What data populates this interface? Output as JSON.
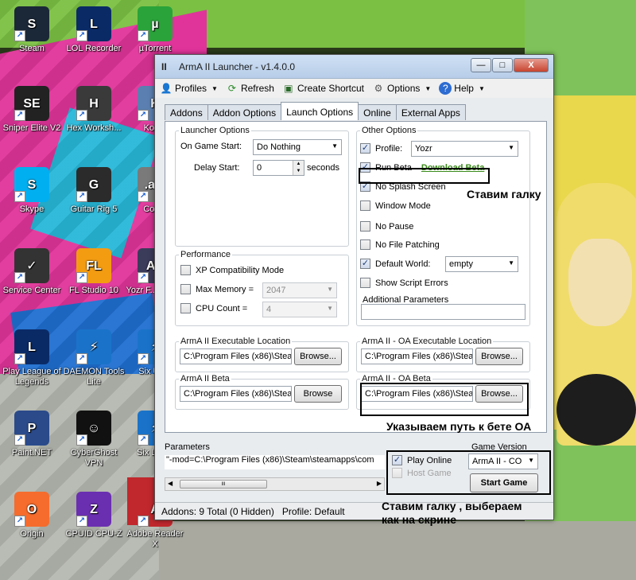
{
  "desktop": {
    "icons": [
      {
        "label": "Steam",
        "glyph": "S",
        "color": "#1b2838"
      },
      {
        "label": "LOL Recorder",
        "glyph": "L",
        "color": "#0a2a66"
      },
      {
        "label": "µTorrent",
        "glyph": "µ",
        "color": "#2aa33a"
      },
      {
        "label": "Sniper Elite V2",
        "glyph": "SE",
        "color": "#222222"
      },
      {
        "label": "Hex Worksh...",
        "glyph": "H",
        "color": "#3a3a3a"
      },
      {
        "label": "Kop...",
        "glyph": "K",
        "color": "#5a7fb0"
      },
      {
        "label": "Skype",
        "glyph": "S",
        "color": "#00aff0"
      },
      {
        "label": "Guitar Rig 5",
        "glyph": "G",
        "color": "#2b2b2b"
      },
      {
        "label": "Con...",
        "glyph": ".avi",
        "color": "#7a7a7a"
      },
      {
        "label": "Service Center",
        "glyph": "✓",
        "color": "#333333"
      },
      {
        "label": "FL Studio 10",
        "glyph": "FL",
        "color": "#f39c12"
      },
      {
        "label": "Yozr F... pres...",
        "glyph": "AE",
        "color": "#3b3b5a"
      },
      {
        "label": "Play League of Legends",
        "glyph": "L",
        "color": "#0a2a66"
      },
      {
        "label": "DAEMON Tools Lite",
        "glyph": "⚡",
        "color": "#1a73c9"
      },
      {
        "label": "Six Up...",
        "glyph": "⚡",
        "color": "#1a73c9"
      },
      {
        "label": "Paint.NET",
        "glyph": "P",
        "color": "#2a4a8a"
      },
      {
        "label": "CyberGhost VPN",
        "glyph": "☺",
        "color": "#111111"
      },
      {
        "label": "Six Lau...",
        "glyph": "⚡",
        "color": "#1a73c9"
      },
      {
        "label": "Origin",
        "glyph": "O",
        "color": "#f56c2d"
      },
      {
        "label": "CPUID CPU-Z",
        "glyph": "Z",
        "color": "#6a2fb0"
      },
      {
        "label": "Adobe Reader X",
        "glyph": "A",
        "color": "#c0282d"
      }
    ]
  },
  "window": {
    "title": "ArmA II Launcher - v1.4.0.0",
    "controls": {
      "minimize": "—",
      "maximize": "□",
      "close": "X"
    }
  },
  "menu": {
    "profiles": "Profiles",
    "refresh": "Refresh",
    "create_shortcut": "Create Shortcut",
    "options": "Options",
    "help": "Help"
  },
  "tabs": [
    "Addons",
    "Addon Options",
    "Launch Options",
    "Online",
    "External Apps"
  ],
  "active_tab": "Launch Options",
  "launcher_options": {
    "legend": "Launcher Options",
    "on_game_start_label": "On Game Start:",
    "on_game_start_value": "Do Nothing",
    "delay_start_label": "Delay Start:",
    "delay_start_value": "0",
    "delay_unit": "seconds"
  },
  "performance": {
    "legend": "Performance",
    "xp_compat": {
      "label": "XP Compatibility Mode",
      "checked": false
    },
    "max_memory": {
      "label": "Max Memory =",
      "checked": false,
      "value": "2047"
    },
    "cpu_count": {
      "label": "CPU Count =",
      "checked": false,
      "value": "4"
    }
  },
  "other_options": {
    "legend": "Other Options",
    "profile": {
      "label": "Profile:",
      "checked": true,
      "value": "Yozr"
    },
    "run_beta": {
      "label": "Run Beta",
      "checked": true,
      "link": "Download Beta"
    },
    "no_splash": {
      "label": "No Splash Screen",
      "checked": true
    },
    "window_mode": {
      "label": "Window Mode",
      "checked": false
    },
    "no_pause": {
      "label": "No Pause",
      "checked": false
    },
    "no_file_patching": {
      "label": "No File Patching",
      "checked": false
    },
    "default_world": {
      "label": "Default World:",
      "checked": true,
      "value": "empty"
    },
    "show_script_errors": {
      "label": "Show Script Errors",
      "checked": false
    },
    "additional_params_label": "Additional Parameters",
    "additional_params_value": ""
  },
  "paths": {
    "arma2_exe": {
      "legend": "ArmA II Executable Location",
      "value": "C:\\Program Files (x86)\\Steam",
      "button": "Browse..."
    },
    "arma2_beta": {
      "legend": "ArmA II Beta",
      "value": "C:\\Program Files (x86)\\Steam",
      "button": "Browse"
    },
    "oa_exe": {
      "legend": "ArmA II - OA Executable Location",
      "value": "C:\\Program Files (x86)\\Steam",
      "button": "Browse..."
    },
    "oa_beta": {
      "legend": "ArmA II - OA Beta",
      "value": "C:\\Program Files (x86)\\Steam",
      "button": "Browse..."
    }
  },
  "parameters": {
    "label": "Parameters",
    "value": "\"-mod=C:\\Program Files (x86)\\Steam\\steamapps\\com",
    "scroll_thumb": "III"
  },
  "game": {
    "version_label": "Game Version",
    "version_value": "ArmA II - CO",
    "play_online": {
      "label": "Play Online",
      "checked": true
    },
    "host_game": {
      "label": "Host Game",
      "checked": false
    },
    "start_button": "Start Game"
  },
  "status": {
    "addons": "Addons: 9 Total (0 Hidden)",
    "profile": "Profile:  Default"
  },
  "annotations": {
    "check_beta": "Ставим галку",
    "oa_beta_path": "Указываем путь к бете ОА",
    "select_version_line1": "Ставим галку , выбераем",
    "select_version_line2": "как на скрине"
  },
  "colors": {
    "link": "#3a8a1a",
    "highlight_border": "#000000"
  }
}
